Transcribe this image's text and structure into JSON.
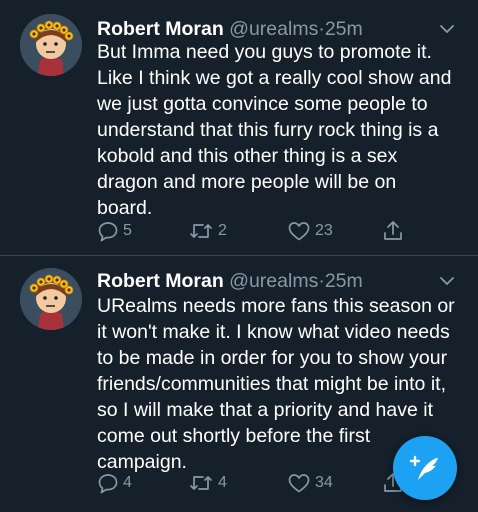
{
  "tweets": [
    {
      "name": "Robert Moran",
      "handle": "@urealms",
      "separator": "·",
      "time": "25m",
      "lines": [
        "But Imma need you guys to promote it.",
        "Like I think we got a really cool show and",
        "we just gotta convince some people to",
        "understand that this furry rock thing is a",
        "kobold and this other thing is a sex",
        "dragon and more people will be on",
        "board."
      ],
      "replies": "5",
      "retweets": "2",
      "likes": "23"
    },
    {
      "name": "Robert Moran",
      "handle": "@urealms",
      "separator": "·",
      "time": "25m",
      "lines": [
        "URealms needs more fans this season or",
        "it won't make it. I know what video needs",
        "to be made in order for you to show your",
        "friends/communities that might be into it,",
        "so I will make that a priority and have it",
        "come out shortly before the first",
        "campaign."
      ],
      "replies": "4",
      "retweets": "4",
      "likes": "34"
    }
  ],
  "colors": {
    "background": "#15202b",
    "divider": "#38444d",
    "secondary_text": "#8899a6",
    "accent": "#1da1f2"
  },
  "icons": [
    "reply-icon",
    "retweet-icon",
    "like-icon",
    "share-icon",
    "chevron-down-icon",
    "compose-tweet-icon"
  ]
}
